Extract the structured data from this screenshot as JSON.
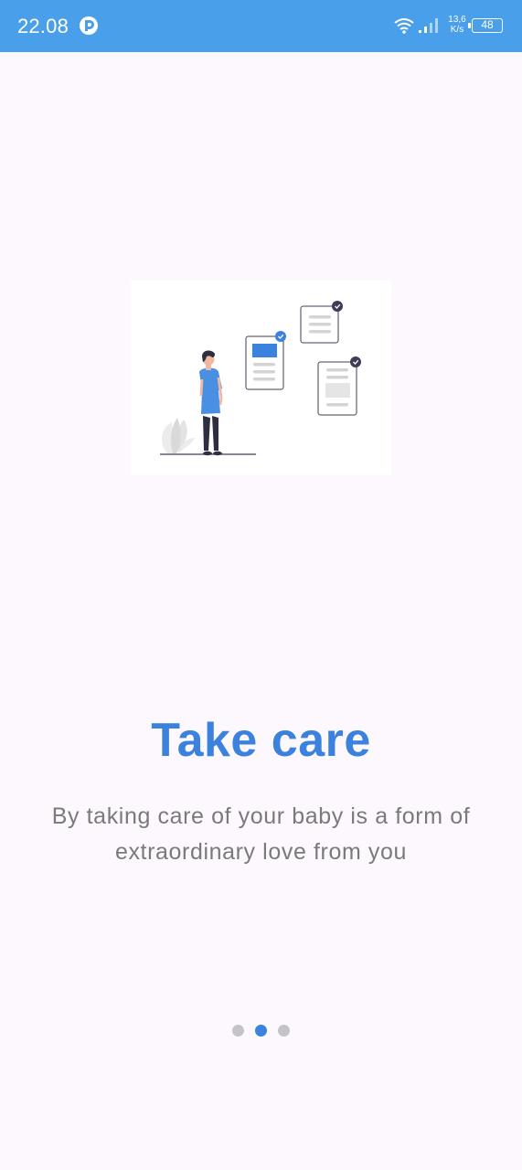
{
  "status_bar": {
    "time": "22.08",
    "speed_value": "13,6",
    "speed_unit": "K/s",
    "battery": "48",
    "icons": [
      "app-notification-icon",
      "wifi-icon",
      "signal-icon",
      "battery-icon"
    ]
  },
  "onboarding": {
    "illustration": "person-with-checked-documents-illustration",
    "title": "Take care",
    "description": "By taking care of your baby is a form of extraordinary love from you",
    "pages": 3,
    "active_page": 2
  },
  "colors": {
    "status_bar": "#499fea",
    "accent": "#3b82de",
    "background": "#fdf8fd",
    "text_secondary": "#7a7a7a",
    "dot_inactive": "#c6c3c8"
  }
}
